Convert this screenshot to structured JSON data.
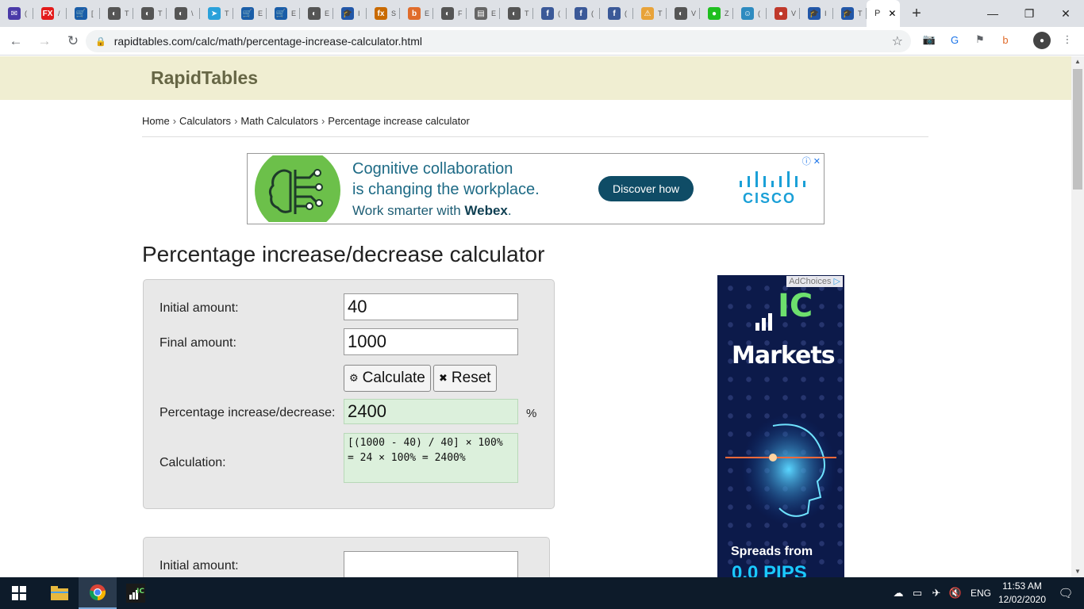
{
  "browser": {
    "tabs": [
      {
        "icon": "mail-icon",
        "color": "#4a3aa8",
        "glyph": "✉",
        "title": "("
      },
      {
        "icon": "fx-icon",
        "color": "#e31b1b",
        "glyph": "FX",
        "title": "/"
      },
      {
        "icon": "cart-icon",
        "color": "#1a5ea8",
        "glyph": "🛒",
        "title": "["
      },
      {
        "icon": "globe-icon",
        "color": "#555",
        "glyph": "◐",
        "title": "T"
      },
      {
        "icon": "globe-icon",
        "color": "#555",
        "glyph": "◐",
        "title": "T"
      },
      {
        "icon": "globe-icon",
        "color": "#555",
        "glyph": "◐",
        "title": "\\"
      },
      {
        "icon": "telegram-icon",
        "color": "#2aa1da",
        "glyph": "➤",
        "title": "T"
      },
      {
        "icon": "cart-icon",
        "color": "#1a5ea8",
        "glyph": "🛒",
        "title": "E"
      },
      {
        "icon": "cart-icon",
        "color": "#1a5ea8",
        "glyph": "🛒",
        "title": "E"
      },
      {
        "icon": "globe-icon",
        "color": "#555",
        "glyph": "◐",
        "title": "E"
      },
      {
        "icon": "graduation-icon",
        "color": "#2257a8",
        "glyph": "🎓",
        "title": "I"
      },
      {
        "icon": "fx-logo-icon",
        "color": "#c96a00",
        "glyph": "fx",
        "title": "S"
      },
      {
        "icon": "b-icon",
        "color": "#e06c2b",
        "glyph": "b",
        "title": "E"
      },
      {
        "icon": "globe-icon",
        "color": "#555",
        "glyph": "◐",
        "title": "F"
      },
      {
        "icon": "image-icon",
        "color": "#666",
        "glyph": "▤",
        "title": "E"
      },
      {
        "icon": "globe-icon",
        "color": "#555",
        "glyph": "◐",
        "title": "T"
      },
      {
        "icon": "facebook-icon",
        "color": "#3b5998",
        "glyph": "f",
        "title": "("
      },
      {
        "icon": "facebook-icon",
        "color": "#3b5998",
        "glyph": "f",
        "title": "("
      },
      {
        "icon": "facebook-icon",
        "color": "#3b5998",
        "glyph": "f",
        "title": "("
      },
      {
        "icon": "warning-icon",
        "color": "#e8a33a",
        "glyph": "⚠",
        "title": "T"
      },
      {
        "icon": "globe-icon",
        "color": "#555",
        "glyph": "◐",
        "title": "V"
      },
      {
        "icon": "green-dot-icon",
        "color": "#1fbf1f",
        "glyph": "●",
        "title": "Z"
      },
      {
        "icon": "mascot-icon",
        "color": "#2e8bc0",
        "glyph": "☺",
        "title": "("
      },
      {
        "icon": "red-app-icon",
        "color": "#c0392b",
        "glyph": "●",
        "title": "V"
      },
      {
        "icon": "graduation-icon",
        "color": "#2257a8",
        "glyph": "🎓",
        "title": "I"
      },
      {
        "icon": "graduation-icon",
        "color": "#2257a8",
        "glyph": "🎓",
        "title": "T"
      }
    ],
    "active_tab_title": "P",
    "address": "rapidtables.com/calc/math/percentage-increase-calculator.html"
  },
  "site": {
    "brand": "RapidTables",
    "breadcrumb": [
      "Home",
      "Calculators",
      "Math Calculators",
      "Percentage increase calculator"
    ],
    "breadcrumb_sep": "›"
  },
  "ad_top": {
    "line1": "Cognitive collaboration",
    "line2": "is changing the workplace.",
    "line3_prefix": "Work smarter with ",
    "line3_bold": "Webex",
    "line3_suffix": ".",
    "cta": "Discover how",
    "advertiser": "CISCO",
    "close": "ⓘ ✕"
  },
  "page": {
    "title": "Percentage increase/decrease calculator"
  },
  "calculator": {
    "initial_label": "Initial amount:",
    "initial_value": "40",
    "final_label": "Final amount:",
    "final_value": "1000",
    "calculate_label": "Calculate",
    "reset_label": "Reset",
    "result_label": "Percentage increase/decrease:",
    "result_value": "2400",
    "result_unit": "%",
    "calculation_label": "Calculation:",
    "calculation_value": "[(1000 - 40) / 40] × 100% = 24 × 100% = 2400%"
  },
  "calculator2": {
    "initial_label": "Initial amount:",
    "initial_value": ""
  },
  "ad_side": {
    "adchoices": "AdChoices",
    "brand_ic": "IC",
    "brand_markets": "Markets",
    "spreads": "Spreads from",
    "pips": "0.0 PIPS"
  },
  "taskbar": {
    "language": "ENG",
    "time": "11:53 AM",
    "date": "12/02/2020"
  }
}
